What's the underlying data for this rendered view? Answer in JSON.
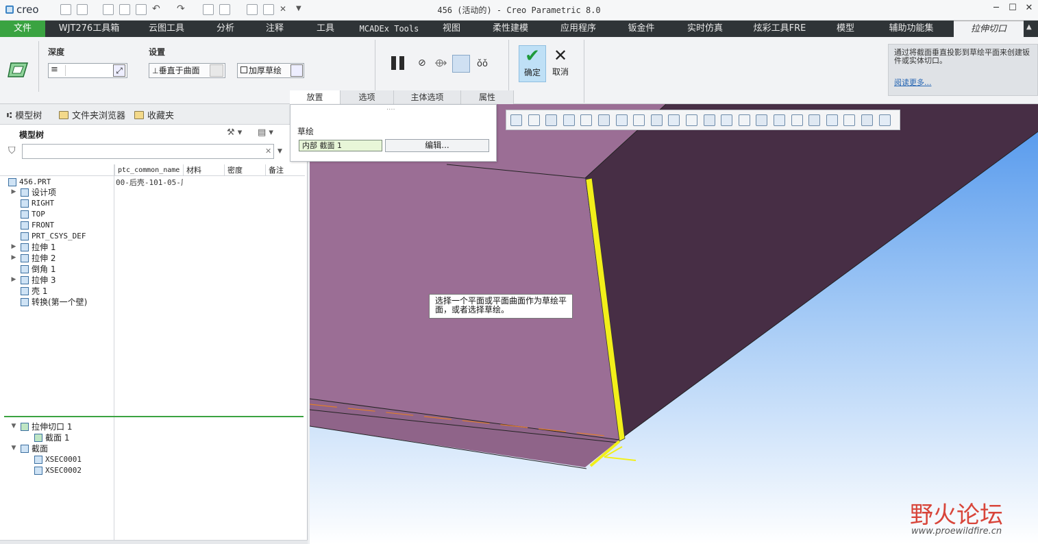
{
  "app": {
    "logo": "creo",
    "window_title": "456 (活动的) - Creo Parametric 8.0",
    "window_buttons": [
      "─",
      "☐",
      "✕"
    ]
  },
  "ribbon_tabs": [
    "文件",
    "WJT276工具箱",
    "云图工具",
    "分析",
    "注释",
    "工具",
    "MCADEx Tools",
    "视图",
    "柔性建模",
    "应用程序",
    "钣金件",
    "实时仿真",
    "炫彩工具FRE",
    "模型",
    "辅助功能集",
    "拉伸切口"
  ],
  "ribbon": {
    "depth_label": "深度",
    "depth_value": "",
    "settings_label": "设置",
    "normal_to_surface": "垂直于曲面",
    "thicken_sketch": "加厚草绘",
    "ok": "确定",
    "cancel": "取消",
    "subtabs": [
      "放置",
      "选项",
      "主体选项",
      "属性"
    ],
    "help_text": "通过将截面垂直投影到草绘平面来创建钣件或实体切口。",
    "help_more": "阅读更多..."
  },
  "left_panel": {
    "nav_tabs": [
      "模型树",
      "文件夹浏览器",
      "收藏夹"
    ],
    "tree_title": "模型树",
    "filter_value": "",
    "columns": [
      "ptc_common_name",
      "材料",
      "密度",
      "备注"
    ],
    "root_common_name": "00-后壳-101-05-厂",
    "tree": [
      {
        "label": "456.PRT",
        "icon": "part-icon",
        "expander": ""
      },
      {
        "label": "设计项",
        "icon": "design-items-icon",
        "expander": "▶"
      },
      {
        "label": "RIGHT",
        "icon": "datum-plane-icon",
        "expander": ""
      },
      {
        "label": "TOP",
        "icon": "datum-plane-icon",
        "expander": ""
      },
      {
        "label": "FRONT",
        "icon": "datum-plane-icon",
        "expander": ""
      },
      {
        "label": "PRT_CSYS_DEF",
        "icon": "csys-icon",
        "expander": ""
      },
      {
        "label": "拉伸 1",
        "icon": "extrude-icon",
        "expander": "▶"
      },
      {
        "label": "拉伸 2",
        "icon": "extrude-icon",
        "expander": "▶"
      },
      {
        "label": "倒角 1",
        "icon": "chamfer-icon",
        "expander": ""
      },
      {
        "label": "拉伸 3",
        "icon": "extrude-icon",
        "expander": "▶"
      },
      {
        "label": "壳 1",
        "icon": "shell-icon",
        "expander": ""
      },
      {
        "label": "转换(第一个壁)",
        "icon": "convert-icon",
        "expander": ""
      }
    ],
    "active_tree": [
      {
        "label": "拉伸切口 1",
        "icon": "extrude-cut-icon",
        "expander": "▼"
      },
      {
        "label": "截面 1",
        "icon": "sketch-icon",
        "expander": ""
      },
      {
        "label": "截面",
        "icon": "section-icon",
        "expander": "▼"
      },
      {
        "label": "XSEC0001",
        "icon": "xsec-icon",
        "expander": ""
      },
      {
        "label": "XSEC0002",
        "icon": "xsec-icon",
        "expander": ""
      }
    ]
  },
  "placement_panel": {
    "sketch_label": "草绘",
    "sketch_value": "内部 截面 1",
    "edit_button": "编辑..."
  },
  "viewport": {
    "tooltip": "选择一个平面或平面曲面作为草绘平面，或者选择草绘。",
    "watermark_text": "野火论坛",
    "watermark_url": "www.proewildfire.cn"
  },
  "colors": {
    "file_tab": "#3aa341",
    "face_front": "#9b6e95",
    "face_side": "#472e45",
    "edge_highlight": "#f2ef1a",
    "bg_top": "#5ea1ef",
    "bg_bottom": "#ffffff"
  }
}
